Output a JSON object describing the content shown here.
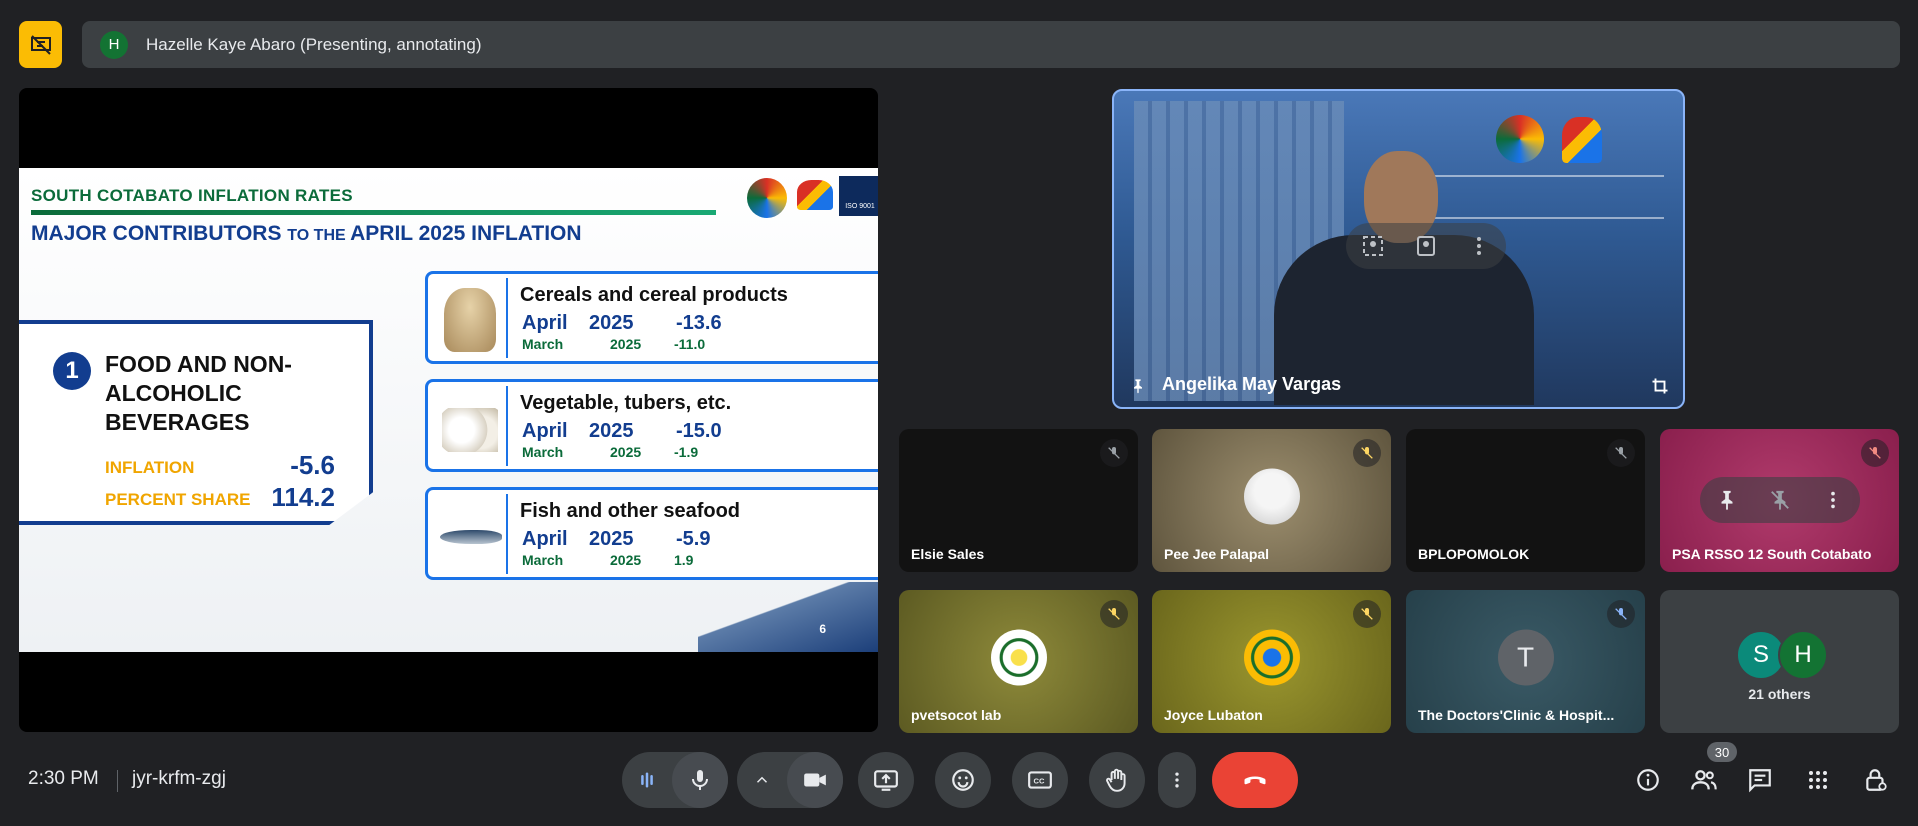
{
  "presentation_bar": {
    "avatar_initial": "H",
    "text": "Hazelle Kaye Abaro (Presenting, annotating)"
  },
  "slide": {
    "title": "SOUTH COTABATO INFLATION RATES",
    "subtitle_a": "MAJOR CONTRIBUTORS ",
    "subtitle_b": "TO THE ",
    "subtitle_c": "APRIL 2025 INFLATION",
    "logo3_text": "ISO 9001",
    "food": {
      "number": "1",
      "name": "FOOD AND NON-ALCOHOLIC BEVERAGES",
      "inflation_label": "INFLATION",
      "inflation_value": "-5.6",
      "share_label": "PERCENT SHARE",
      "share_value": "114.2"
    },
    "items": [
      {
        "title": "Cereals and cereal products",
        "m1": "April",
        "y1": "2025",
        "v1": "-13.6",
        "m2": "March",
        "y2": "2025",
        "v2": "-11.0"
      },
      {
        "title": "Vegetable, tubers, etc.",
        "m1": "April",
        "y1": "2025",
        "v1": "-15.0",
        "m2": "March",
        "y2": "2025",
        "v2": "-1.9"
      },
      {
        "title": "Fish and other seafood",
        "m1": "April",
        "y1": "2025",
        "v1": "-5.9",
        "m2": "March",
        "y2": "2025",
        "v2": "1.9"
      }
    ],
    "page_number": "6"
  },
  "featured": {
    "name": "Angelika May Vargas"
  },
  "tiles": [
    {
      "name": "Elsie Sales"
    },
    {
      "name": "Pee Jee Palapal"
    },
    {
      "name": "BPLOPOMOLOK"
    },
    {
      "name": "PSA RSSO 12 South Cotabato"
    },
    {
      "name": "pvetsocot lab"
    },
    {
      "name": "Joyce Lubaton"
    },
    {
      "name": "The Doctors'Clinic & Hospit...",
      "initial": "T"
    },
    {
      "name": "21 others",
      "initial_a": "S",
      "initial_b": "H"
    }
  ],
  "bottom": {
    "time": "2:30 PM",
    "meeting_code": "jyr-krfm-zgj",
    "people_count": "30"
  },
  "colors": {
    "bg": "#202124",
    "accent_yellow": "#fbbc04",
    "end_call_red": "#ea4335",
    "slide_blue": "#123d8f",
    "slide_green": "#0b6b3a"
  }
}
